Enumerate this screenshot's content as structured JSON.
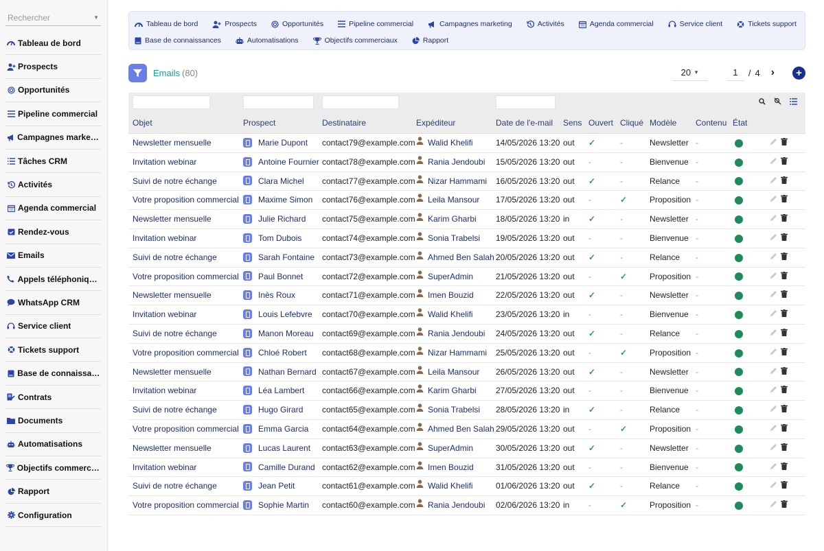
{
  "sidebar": {
    "search_placeholder": "Rechercher",
    "items": [
      {
        "label": "Tableau de bord",
        "icon": "gauge-icon"
      },
      {
        "label": "Prospects",
        "icon": "user-plus-icon"
      },
      {
        "label": "Opportunités",
        "icon": "target-icon"
      },
      {
        "label": "Pipeline commercial",
        "icon": "list-icon"
      },
      {
        "label": "Campagnes marketing",
        "icon": "megaphone-icon"
      },
      {
        "label": "Tâches CRM",
        "icon": "tasks-icon"
      },
      {
        "label": "Activités",
        "icon": "history-icon"
      },
      {
        "label": "Agenda commercial",
        "icon": "calendar-icon"
      },
      {
        "label": "Rendez-vous",
        "icon": "calendar-check-icon"
      },
      {
        "label": "Emails",
        "icon": "envelope-icon"
      },
      {
        "label": "Appels téléphoniques",
        "icon": "phone-icon"
      },
      {
        "label": "WhatsApp CRM",
        "icon": "chat-icon"
      },
      {
        "label": "Service client",
        "icon": "headset-icon"
      },
      {
        "label": "Tickets support",
        "icon": "lifebuoy-icon"
      },
      {
        "label": "Base de connaissan…",
        "icon": "book-icon"
      },
      {
        "label": "Contrats",
        "icon": "contract-icon"
      },
      {
        "label": "Documents",
        "icon": "folder-icon"
      },
      {
        "label": "Automatisations",
        "icon": "robot-icon"
      },
      {
        "label": "Objectifs commerciaux",
        "icon": "trophy-icon"
      },
      {
        "label": "Rapport",
        "icon": "pie-chart-icon"
      },
      {
        "label": "Configuration",
        "icon": "gear-icon"
      }
    ]
  },
  "topnav": {
    "row1": [
      {
        "label": "Tableau de bord",
        "icon": "gauge-icon"
      },
      {
        "label": "Prospects",
        "icon": "user-plus-icon"
      },
      {
        "label": "Opportunités",
        "icon": "target-icon"
      },
      {
        "label": "Pipeline commercial",
        "icon": "list-icon"
      },
      {
        "label": "Campagnes marketing",
        "icon": "megaphone-icon"
      },
      {
        "label": "Activités",
        "icon": "history-icon"
      },
      {
        "label": "Agenda commercial",
        "icon": "calendar-icon"
      },
      {
        "label": "Service client",
        "icon": "headset-icon"
      },
      {
        "label": "Tickets support",
        "icon": "lifebuoy-icon"
      }
    ],
    "row2": [
      {
        "label": "Base de connaissances",
        "icon": "book-icon"
      },
      {
        "label": "Automatisations",
        "icon": "robot-icon"
      },
      {
        "label": "Objectifs commerciaux",
        "icon": "trophy-icon"
      },
      {
        "label": "Rapport",
        "icon": "pie-chart-icon"
      }
    ]
  },
  "header": {
    "title": "Emails",
    "count": "(80)",
    "per_page": "20",
    "page": "1",
    "page_sep": "/",
    "page_total": "4",
    "next": "›",
    "add": "+"
  },
  "columns": [
    "Objet",
    "Prospect",
    "Destinataire",
    "Expéditeur",
    "Date de l'e-mail",
    "Sens",
    "Ouvert",
    "Cliqué",
    "Modèle",
    "Contenu",
    "État"
  ],
  "rows": [
    {
      "objet": "Newsletter mensuelle",
      "prospect": "Marie Dupont",
      "dest": "contact79@example.com",
      "exp": "Walid Khelifi",
      "date": "14/05/2026 13:20",
      "sens": "out",
      "ouvert": true,
      "clique": false,
      "modele": "Newsletter"
    },
    {
      "objet": "Invitation webinar",
      "prospect": "Antoine Fournier",
      "dest": "contact78@example.com",
      "exp": "Rania Jendoubi",
      "date": "15/05/2026 13:20",
      "sens": "out",
      "ouvert": false,
      "clique": false,
      "modele": "Bienvenue"
    },
    {
      "objet": "Suivi de notre échange",
      "prospect": "Clara Michel",
      "dest": "contact77@example.com",
      "exp": "Nizar Hammami",
      "date": "16/05/2026 13:20",
      "sens": "out",
      "ouvert": true,
      "clique": false,
      "modele": "Relance"
    },
    {
      "objet": "Votre proposition commerciale",
      "prospect": "Maxime Simon",
      "dest": "contact76@example.com",
      "exp": "Leila Mansour",
      "date": "17/05/2026 13:20",
      "sens": "out",
      "ouvert": false,
      "clique": true,
      "modele": "Proposition"
    },
    {
      "objet": "Newsletter mensuelle",
      "prospect": "Julie Richard",
      "dest": "contact75@example.com",
      "exp": "Karim Gharbi",
      "date": "18/05/2026 13:20",
      "sens": "in",
      "ouvert": true,
      "clique": false,
      "modele": "Newsletter"
    },
    {
      "objet": "Invitation webinar",
      "prospect": "Tom Dubois",
      "dest": "contact74@example.com",
      "exp": "Sonia Trabelsi",
      "date": "19/05/2026 13:20",
      "sens": "out",
      "ouvert": false,
      "clique": false,
      "modele": "Bienvenue"
    },
    {
      "objet": "Suivi de notre échange",
      "prospect": "Sarah Fontaine",
      "dest": "contact73@example.com",
      "exp": "Ahmed Ben Salah",
      "date": "20/05/2026 13:20",
      "sens": "out",
      "ouvert": true,
      "clique": false,
      "modele": "Relance"
    },
    {
      "objet": "Votre proposition commerciale",
      "prospect": "Paul Bonnet",
      "dest": "contact72@example.com",
      "exp": "SuperAdmin",
      "date": "21/05/2026 13:20",
      "sens": "out",
      "ouvert": false,
      "clique": true,
      "modele": "Proposition"
    },
    {
      "objet": "Newsletter mensuelle",
      "prospect": "Inès Roux",
      "dest": "contact71@example.com",
      "exp": "Imen Bouzid",
      "date": "22/05/2026 13:20",
      "sens": "out",
      "ouvert": true,
      "clique": false,
      "modele": "Newsletter"
    },
    {
      "objet": "Invitation webinar",
      "prospect": "Louis Lefebvre",
      "dest": "contact70@example.com",
      "exp": "Walid Khelifi",
      "date": "23/05/2026 13:20",
      "sens": "in",
      "ouvert": false,
      "clique": false,
      "modele": "Bienvenue"
    },
    {
      "objet": "Suivi de notre échange",
      "prospect": "Manon Moreau",
      "dest": "contact69@example.com",
      "exp": "Rania Jendoubi",
      "date": "24/05/2026 13:20",
      "sens": "out",
      "ouvert": true,
      "clique": false,
      "modele": "Relance"
    },
    {
      "objet": "Votre proposition commerciale",
      "prospect": "Chloé Robert",
      "dest": "contact68@example.com",
      "exp": "Nizar Hammami",
      "date": "25/05/2026 13:20",
      "sens": "out",
      "ouvert": false,
      "clique": true,
      "modele": "Proposition"
    },
    {
      "objet": "Newsletter mensuelle",
      "prospect": "Nathan Bernard",
      "dest": "contact67@example.com",
      "exp": "Leila Mansour",
      "date": "26/05/2026 13:20",
      "sens": "out",
      "ouvert": true,
      "clique": false,
      "modele": "Newsletter"
    },
    {
      "objet": "Invitation webinar",
      "prospect": "Léa Lambert",
      "dest": "contact66@example.com",
      "exp": "Karim Gharbi",
      "date": "27/05/2026 13:20",
      "sens": "out",
      "ouvert": false,
      "clique": false,
      "modele": "Bienvenue"
    },
    {
      "objet": "Suivi de notre échange",
      "prospect": "Hugo Girard",
      "dest": "contact65@example.com",
      "exp": "Sonia Trabelsi",
      "date": "28/05/2026 13:20",
      "sens": "in",
      "ouvert": true,
      "clique": false,
      "modele": "Relance"
    },
    {
      "objet": "Votre proposition commerciale",
      "prospect": "Emma Garcia",
      "dest": "contact64@example.com",
      "exp": "Ahmed Ben Salah",
      "date": "29/05/2026 13:20",
      "sens": "out",
      "ouvert": false,
      "clique": true,
      "modele": "Proposition"
    },
    {
      "objet": "Newsletter mensuelle",
      "prospect": "Lucas Laurent",
      "dest": "contact63@example.com",
      "exp": "SuperAdmin",
      "date": "30/05/2026 13:20",
      "sens": "out",
      "ouvert": true,
      "clique": false,
      "modele": "Newsletter"
    },
    {
      "objet": "Invitation webinar",
      "prospect": "Camille Durand",
      "dest": "contact62@example.com",
      "exp": "Imen Bouzid",
      "date": "31/05/2026 13:20",
      "sens": "out",
      "ouvert": false,
      "clique": false,
      "modele": "Bienvenue"
    },
    {
      "objet": "Suivi de notre échange",
      "prospect": "Jean Petit",
      "dest": "contact61@example.com",
      "exp": "Walid Khelifi",
      "date": "01/06/2026 13:20",
      "sens": "out",
      "ouvert": true,
      "clique": false,
      "modele": "Relance"
    },
    {
      "objet": "Votre proposition commerciale",
      "prospect": "Sophie Martin",
      "dest": "contact60@example.com",
      "exp": "Rania Jendoubi",
      "date": "02/06/2026 13:20",
      "sens": "in",
      "ouvert": false,
      "clique": true,
      "modele": "Proposition"
    }
  ],
  "symbols": {
    "dash": "-",
    "check": "✓"
  },
  "colors": {
    "accent": "#1c2e6b",
    "title": "#1a9c8f",
    "status_green": "#1f8b5a",
    "check_green": "#2f9e44",
    "badge": "#6b7ee8"
  }
}
